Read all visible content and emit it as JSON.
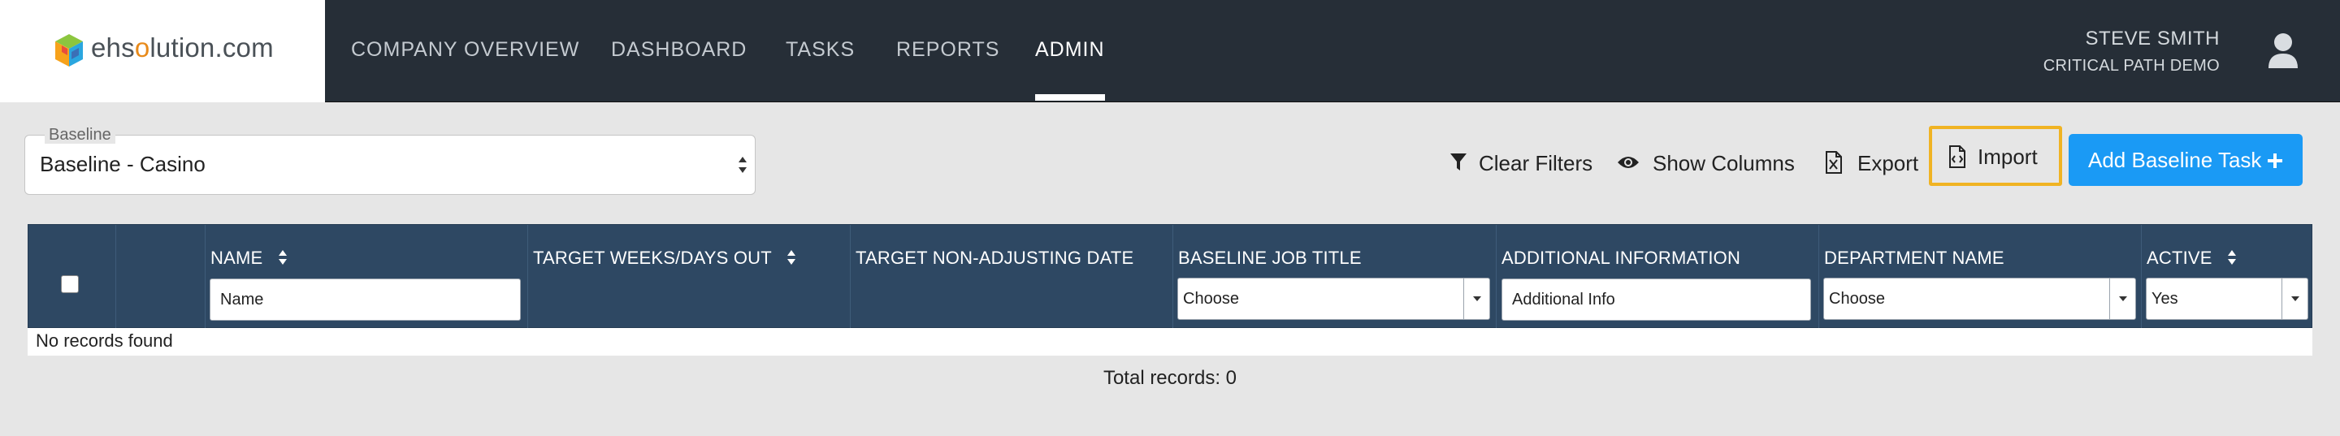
{
  "brand": {
    "logo_text_pre": "ehs",
    "logo_text_o": "o",
    "logo_text_post": "lution.com"
  },
  "nav": {
    "items": [
      {
        "label": "COMPANY OVERVIEW",
        "active": false
      },
      {
        "label": "DASHBOARD",
        "active": false
      },
      {
        "label": "TASKS",
        "active": false
      },
      {
        "label": "REPORTS",
        "active": false
      },
      {
        "label": "ADMIN",
        "active": true
      }
    ]
  },
  "user": {
    "name": "STEVE SMITH",
    "company": "CRITICAL PATH DEMO",
    "icon": "user-avatar-icon"
  },
  "baseline": {
    "legend": "Baseline",
    "value": "Baseline - Casino"
  },
  "toolbar": {
    "clear_filters": "Clear Filters",
    "show_columns": "Show Columns",
    "export": "Export",
    "import": "Import",
    "add_task": "Add Baseline Task"
  },
  "table": {
    "columns": {
      "name": "NAME",
      "target_weeks": "TARGET WEEKS/DAYS OUT",
      "target_non_adjusting": "TARGET NON-ADJUSTING DATE",
      "job_title": "BASELINE JOB TITLE",
      "additional_info": "ADDITIONAL INFORMATION",
      "department": "DEPARTMENT NAME",
      "active": "ACTIVE"
    },
    "filters": {
      "name_placeholder": "Name",
      "job_title_value": "Choose",
      "additional_info_placeholder": "Additional Info",
      "department_value": "Choose",
      "active_value": "Yes"
    },
    "empty_message": "No records found",
    "total": "Total records: 0"
  },
  "colors": {
    "nav_bg": "#262e37",
    "table_header_bg": "#2e4863",
    "primary_button": "#1a9af5",
    "highlight_border": "#f0b323",
    "page_bg": "#e6e6e6"
  }
}
